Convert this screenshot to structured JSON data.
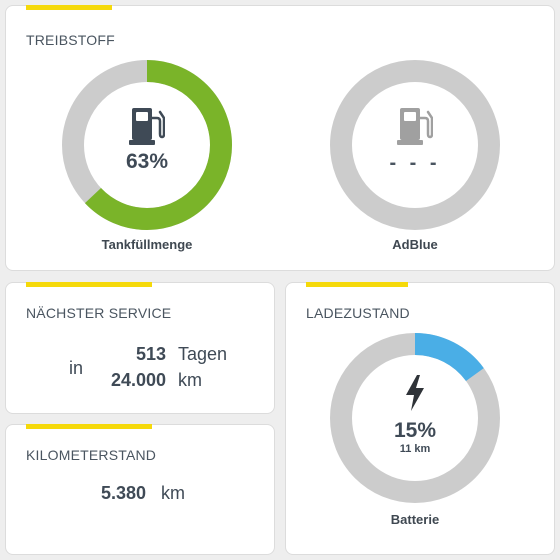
{
  "colors": {
    "accent": "#f5d90a",
    "fuel": "#7ab429",
    "charge": "#4aaee6",
    "track": "#cccccc"
  },
  "treibstoff": {
    "title": "TREIBSTOFF",
    "fuel_gauge": {
      "value_text": "63%",
      "fill_fraction": 0.63,
      "label": "Tankfüllmenge",
      "icon": "fuel-pump-icon"
    },
    "adblue_gauge": {
      "value_text": "- - -",
      "fill_fraction": 0,
      "label": "AdBlue",
      "icon": "fuel-pump-icon"
    }
  },
  "service": {
    "title": "NÄCHSTER SERVICE",
    "prefix": "in",
    "days_value": "513",
    "days_unit": "Tagen",
    "km_value": "24.000",
    "km_unit": "km"
  },
  "odometer": {
    "title": "KILOMETERSTAND",
    "value": "5.380",
    "unit": "km"
  },
  "ladezustand": {
    "title": "LADEZUSTAND",
    "value_text": "15%",
    "fill_fraction": 0.15,
    "range_text": "11 km",
    "label": "Batterie",
    "icon": "lightning-bolt-icon"
  }
}
